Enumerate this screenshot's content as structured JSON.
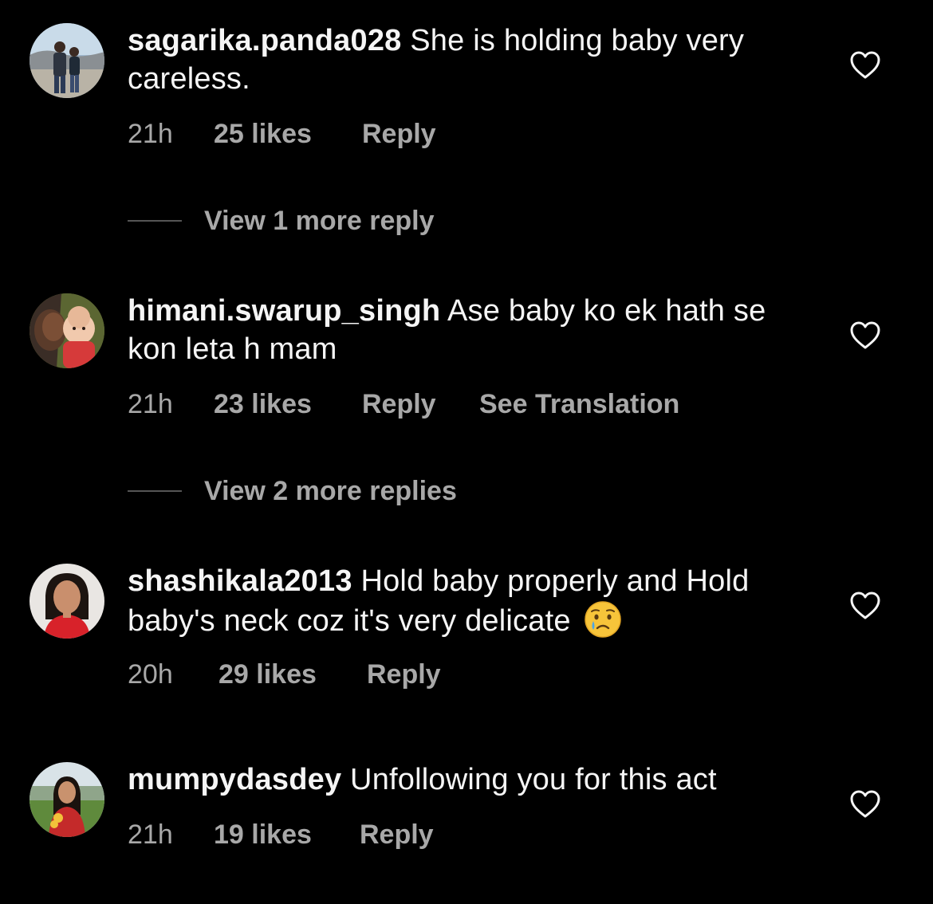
{
  "comments": [
    {
      "username": "sagarika.panda028",
      "text": " She is holding baby very careless.",
      "time": "21h",
      "likes": "25 likes",
      "reply": "Reply",
      "translate": "",
      "view_replies": "View 1 more reply",
      "avatar_icon": "avatar-photo-couple-lake"
    },
    {
      "username": "himani.swarup_singh",
      "text": " Ase baby ko ek hath se kon leta h mam",
      "time": "21h",
      "likes": "23 likes",
      "reply": "Reply",
      "translate": "See Translation",
      "view_replies": "View 2 more replies",
      "avatar_icon": "avatar-photo-man-baby"
    },
    {
      "username": "shashikala2013",
      "text": " Hold baby properly and Hold baby's neck coz it's very delicate ",
      "emoji": "crying-face-emoji",
      "time": "20h",
      "likes": "29 likes",
      "reply": "Reply",
      "translate": "",
      "view_replies": "",
      "avatar_icon": "avatar-photo-woman-red"
    },
    {
      "username": "mumpydasdey",
      "text": " Unfollowing you for this act",
      "time": "21h",
      "likes": "19 likes",
      "reply": "Reply",
      "translate": "",
      "view_replies": "",
      "avatar_icon": "avatar-photo-woman-field"
    }
  ],
  "colors": {
    "background": "#000000",
    "primary_text": "#f5f5f5",
    "secondary_text": "#a8a8a8",
    "divider": "#555555"
  }
}
